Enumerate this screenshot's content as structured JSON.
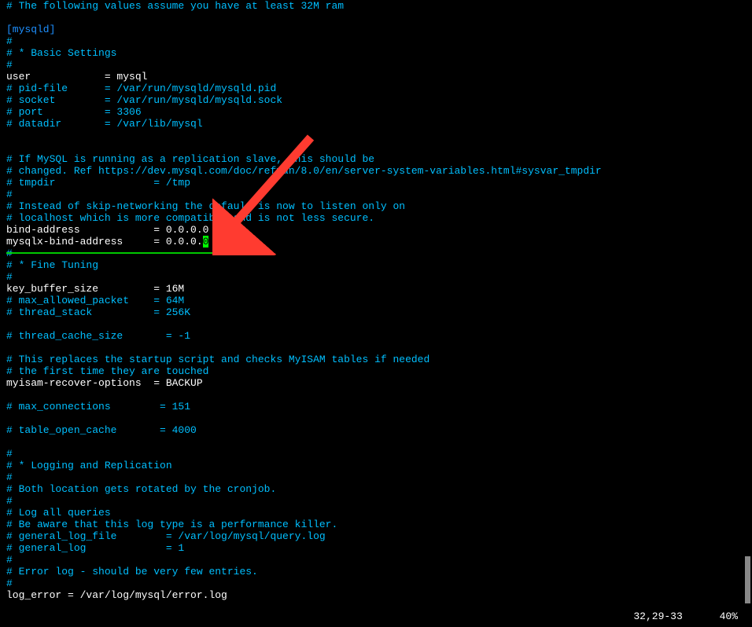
{
  "lines": [
    {
      "parts": [
        {
          "cls": "comment",
          "text": "# The following values assume you have at least 32M ram"
        }
      ]
    },
    {
      "parts": [
        {
          "cls": "plain",
          "text": ""
        }
      ]
    },
    {
      "parts": [
        {
          "cls": "section",
          "text": "[mysqld]"
        }
      ]
    },
    {
      "parts": [
        {
          "cls": "comment",
          "text": "#"
        }
      ]
    },
    {
      "parts": [
        {
          "cls": "comment",
          "text": "# * Basic Settings"
        }
      ]
    },
    {
      "parts": [
        {
          "cls": "comment",
          "text": "#"
        }
      ]
    },
    {
      "parts": [
        {
          "cls": "plain",
          "text": "user            = mysql"
        }
      ]
    },
    {
      "parts": [
        {
          "cls": "comment",
          "text": "# pid-file      = /var/run/mysqld/mysqld.pid"
        }
      ]
    },
    {
      "parts": [
        {
          "cls": "comment",
          "text": "# socket        = /var/run/mysqld/mysqld.sock"
        }
      ]
    },
    {
      "parts": [
        {
          "cls": "comment",
          "text": "# port          = 3306"
        }
      ]
    },
    {
      "parts": [
        {
          "cls": "comment",
          "text": "# datadir       = /var/lib/mysql"
        }
      ]
    },
    {
      "parts": [
        {
          "cls": "plain",
          "text": ""
        }
      ]
    },
    {
      "parts": [
        {
          "cls": "plain",
          "text": ""
        }
      ]
    },
    {
      "parts": [
        {
          "cls": "comment",
          "text": "# If MySQL is running as a replication slave, this should be"
        }
      ]
    },
    {
      "parts": [
        {
          "cls": "comment",
          "text": "# changed. Ref https://dev.mysql.com/doc/refman/8.0/en/server-system-variables.html#sysvar_tmpdir"
        }
      ]
    },
    {
      "parts": [
        {
          "cls": "comment",
          "text": "# tmpdir                = /tmp"
        }
      ]
    },
    {
      "parts": [
        {
          "cls": "comment",
          "text": "#"
        }
      ]
    },
    {
      "parts": [
        {
          "cls": "comment",
          "text": "# Instead of skip-networking the default is now to listen only on"
        }
      ]
    },
    {
      "parts": [
        {
          "cls": "comment",
          "text": "# localhost which is more compatible and is not less secure."
        }
      ]
    },
    {
      "parts": [
        {
          "cls": "plain",
          "text": "bind-address            = 0.0.0.0"
        }
      ]
    },
    {
      "parts": [
        {
          "cls": "plain",
          "text": "mysqlx-bind-address     = 0.0.0."
        },
        {
          "cls": "cursor-char",
          "text": "0"
        }
      ]
    },
    {
      "parts": [
        {
          "cls": "comment",
          "text": "#"
        }
      ]
    },
    {
      "parts": [
        {
          "cls": "comment",
          "text": "# * Fine Tuning"
        }
      ]
    },
    {
      "parts": [
        {
          "cls": "comment",
          "text": "#"
        }
      ]
    },
    {
      "parts": [
        {
          "cls": "plain",
          "text": "key_buffer_size         = 16M"
        }
      ]
    },
    {
      "parts": [
        {
          "cls": "comment",
          "text": "# max_allowed_packet    = 64M"
        }
      ]
    },
    {
      "parts": [
        {
          "cls": "comment",
          "text": "# thread_stack          = 256K"
        }
      ]
    },
    {
      "parts": [
        {
          "cls": "plain",
          "text": ""
        }
      ]
    },
    {
      "parts": [
        {
          "cls": "comment",
          "text": "# thread_cache_size       = -1"
        }
      ]
    },
    {
      "parts": [
        {
          "cls": "plain",
          "text": ""
        }
      ]
    },
    {
      "parts": [
        {
          "cls": "comment",
          "text": "# This replaces the startup script and checks MyISAM tables if needed"
        }
      ]
    },
    {
      "parts": [
        {
          "cls": "comment",
          "text": "# the first time they are touched"
        }
      ]
    },
    {
      "parts": [
        {
          "cls": "plain",
          "text": "myisam-recover-options  = BACKUP"
        }
      ]
    },
    {
      "parts": [
        {
          "cls": "plain",
          "text": ""
        }
      ]
    },
    {
      "parts": [
        {
          "cls": "comment",
          "text": "# max_connections        = 151"
        }
      ]
    },
    {
      "parts": [
        {
          "cls": "plain",
          "text": ""
        }
      ]
    },
    {
      "parts": [
        {
          "cls": "comment",
          "text": "# table_open_cache       = 4000"
        }
      ]
    },
    {
      "parts": [
        {
          "cls": "plain",
          "text": ""
        }
      ]
    },
    {
      "parts": [
        {
          "cls": "comment",
          "text": "#"
        }
      ]
    },
    {
      "parts": [
        {
          "cls": "comment",
          "text": "# * Logging and Replication"
        }
      ]
    },
    {
      "parts": [
        {
          "cls": "comment",
          "text": "#"
        }
      ]
    },
    {
      "parts": [
        {
          "cls": "comment",
          "text": "# Both location gets rotated by the cronjob."
        }
      ]
    },
    {
      "parts": [
        {
          "cls": "comment",
          "text": "#"
        }
      ]
    },
    {
      "parts": [
        {
          "cls": "comment",
          "text": "# Log all queries"
        }
      ]
    },
    {
      "parts": [
        {
          "cls": "comment",
          "text": "# Be aware that this log type is a performance killer."
        }
      ]
    },
    {
      "parts": [
        {
          "cls": "comment",
          "text": "# general_log_file        = /var/log/mysql/query.log"
        }
      ]
    },
    {
      "parts": [
        {
          "cls": "comment",
          "text": "# general_log             = 1"
        }
      ]
    },
    {
      "parts": [
        {
          "cls": "comment",
          "text": "#"
        }
      ]
    },
    {
      "parts": [
        {
          "cls": "comment",
          "text": "# Error log - should be very few entries."
        }
      ]
    },
    {
      "parts": [
        {
          "cls": "comment",
          "text": "#"
        }
      ]
    },
    {
      "parts": [
        {
          "cls": "plain",
          "text": "log_error = /var/log/mysql/error.log"
        }
      ]
    }
  ],
  "status": {
    "position": "32,29-33",
    "percent": "40%"
  }
}
